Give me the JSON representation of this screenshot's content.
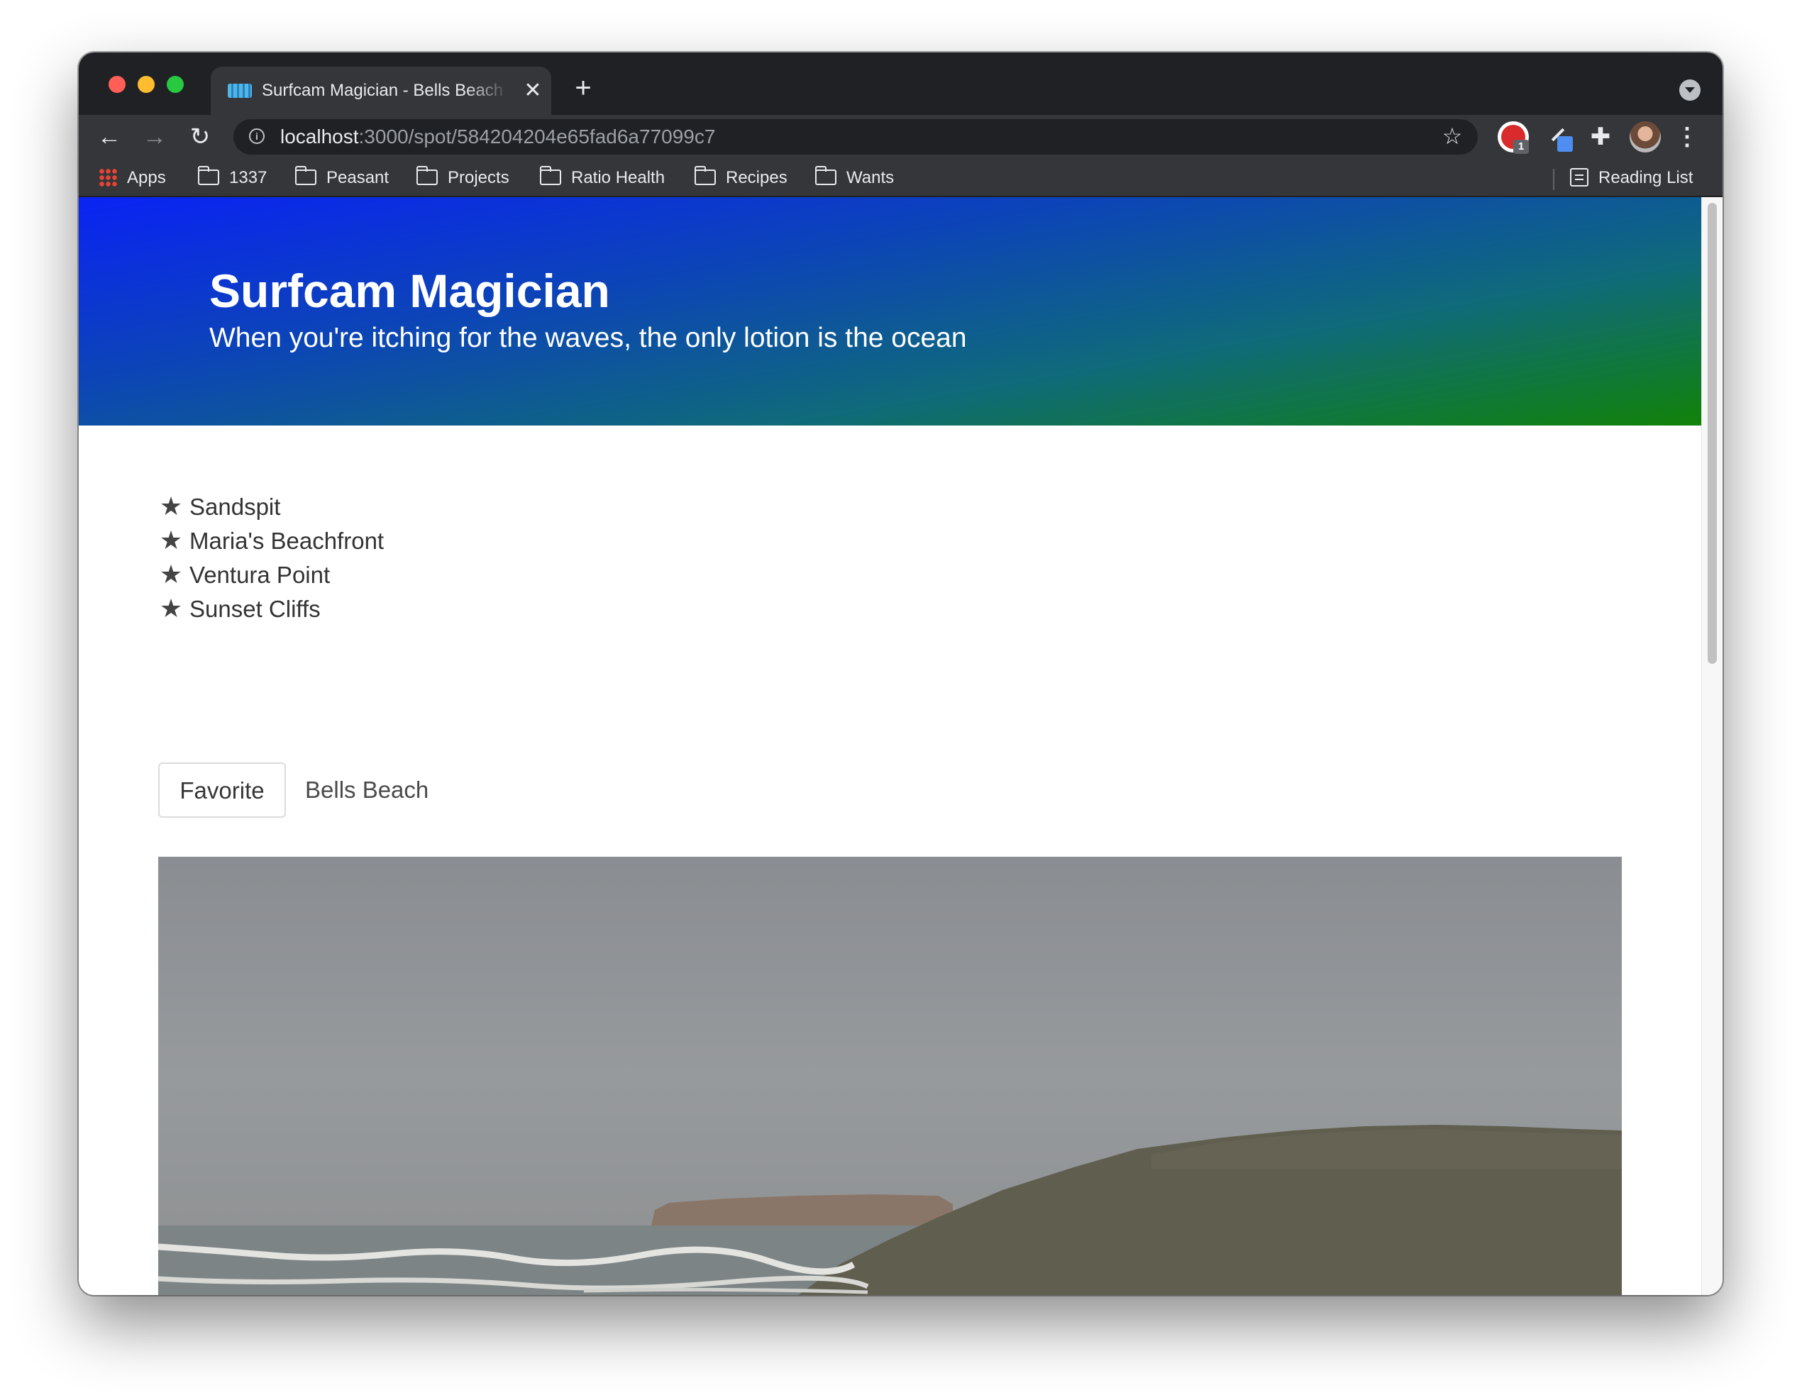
{
  "browser": {
    "tab_title": "Surfcam Magician - Bells Beach",
    "new_tab_label": "+",
    "url_host": "localhost",
    "url_rest": ":3000/spot/584204204e65fad6a77099c7",
    "extension_badge": "1",
    "bookmarks": [
      {
        "label": "Apps",
        "icon": "apps-grid-icon"
      },
      {
        "label": "1337",
        "icon": "folder-icon"
      },
      {
        "label": "Peasant",
        "icon": "folder-icon"
      },
      {
        "label": "Projects",
        "icon": "folder-icon"
      },
      {
        "label": "Ratio Health",
        "icon": "folder-icon"
      },
      {
        "label": "Recipes",
        "icon": "folder-icon"
      },
      {
        "label": "Wants",
        "icon": "folder-icon"
      }
    ],
    "reading_list_label": "Reading List"
  },
  "hero": {
    "title": "Surfcam Magician",
    "subtitle": "When you're itching for the waves, the only lotion is the ocean",
    "gradient_colors": [
      "#0a23f4",
      "#118209"
    ]
  },
  "favorites": [
    {
      "label": "Sandspit"
    },
    {
      "label": "Maria's Beachfront"
    },
    {
      "label": "Ventura Point"
    },
    {
      "label": "Sunset Cliffs"
    }
  ],
  "spot": {
    "favorite_button_label": "Favorite",
    "name": "Bells Beach"
  }
}
